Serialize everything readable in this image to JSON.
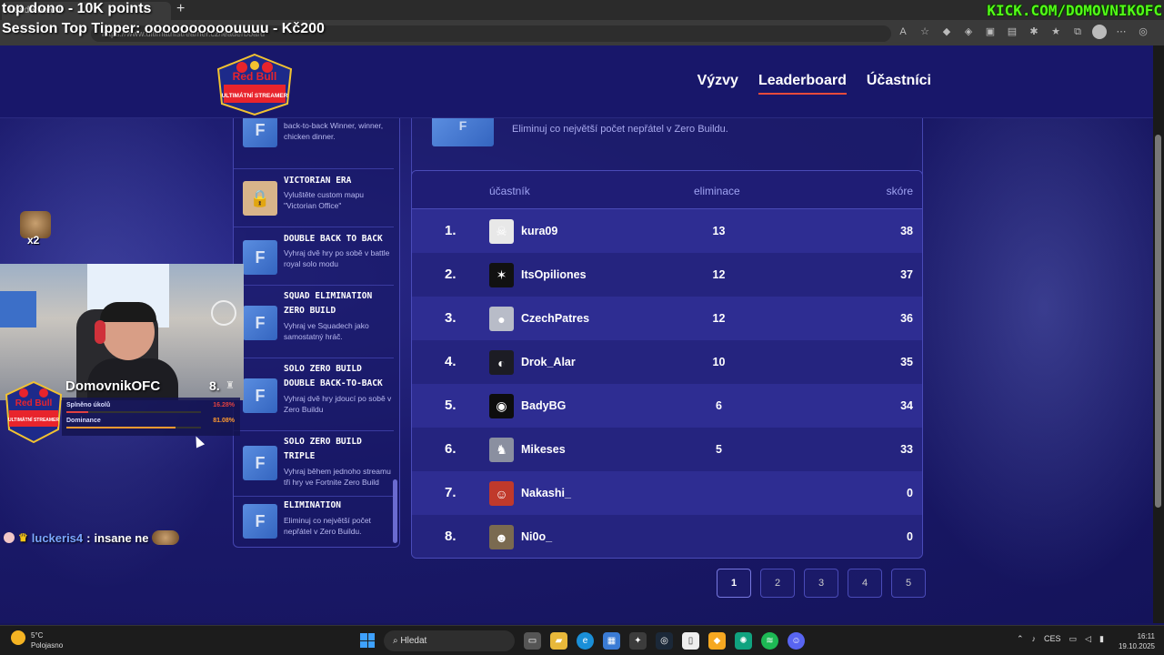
{
  "browser": {
    "tab_label": "Leaderboard",
    "url": "https://www.ultimatnistreamer.cz/leaderboard"
  },
  "site": {
    "logo_text_top": "Red Bull",
    "logo_text_bottom": "ULTIMÁTNÍ STREAMER",
    "nav": [
      {
        "label": "Výzvy",
        "active": false
      },
      {
        "label": "Leaderboard",
        "active": true
      },
      {
        "label": "Účastníci",
        "active": false
      }
    ],
    "challenges": [
      {
        "title": "",
        "desc": "back-to-back Winner, winner, chicken dinner.",
        "thumb": "F"
      },
      {
        "title": "VICTORIAN ERA",
        "desc": "Vyluštěte custom mapu \"Victorian Office\"",
        "thumb": "🔒"
      },
      {
        "title": "DOUBLE BACK TO BACK",
        "desc": "Vyhraj dvě hry po sobě v battle royal solo modu",
        "thumb": "F"
      },
      {
        "title": "SQUAD ELIMINATION ZERO BUILD",
        "desc": "Vyhraj ve Squadech jako samostatný hráč.",
        "thumb": "F"
      },
      {
        "title": "SOLO ZERO BUILD DOUBLE BACK-TO-BACK",
        "desc": "Vyhraj dvě hry jdoucí po sobě v Zero Buildu",
        "thumb": "F"
      },
      {
        "title": "SOLO ZERO BUILD TRIPLE",
        "desc": "Vyhraj během jednoho streamu tři hry ve Fortnite Zero Build",
        "thumb": "F"
      },
      {
        "title": "ELIMINATION",
        "desc": "Eliminuj co největší počet nepřátel v Zero Buildu.",
        "thumb": "F"
      }
    ],
    "info": {
      "thumb": "F",
      "desc": "Eliminuj co největší počet nepřátel v Zero Buildu."
    },
    "board": {
      "headers": {
        "participant": "účastník",
        "eliminations": "eliminace",
        "score": "skóre"
      },
      "rows": [
        {
          "rank": "1.",
          "name": "kura09",
          "elims": "13",
          "score": "38",
          "avatar_color": "#e8e8e8",
          "avatar_glyph": "☠"
        },
        {
          "rank": "2.",
          "name": "ItsOpiliones",
          "elims": "12",
          "score": "37",
          "avatar_color": "#111111",
          "avatar_glyph": "✶"
        },
        {
          "rank": "3.",
          "name": "CzechPatres",
          "elims": "12",
          "score": "36",
          "avatar_color": "#b8bcc8",
          "avatar_glyph": "●"
        },
        {
          "rank": "4.",
          "name": "Drok_Alar",
          "elims": "10",
          "score": "35",
          "avatar_color": "#1c1c24",
          "avatar_glyph": "◐"
        },
        {
          "rank": "5.",
          "name": "BadyBG",
          "elims": "6",
          "score": "34",
          "avatar_color": "#0d0d0d",
          "avatar_glyph": "◉"
        },
        {
          "rank": "6.",
          "name": "Mikeses",
          "elims": "5",
          "score": "33",
          "avatar_color": "#8a8fa0",
          "avatar_glyph": "♞"
        },
        {
          "rank": "7.",
          "name": "Nakashi_",
          "elims": "",
          "score": "0",
          "avatar_color": "#c0392b",
          "avatar_glyph": "☺"
        },
        {
          "rank": "8.",
          "name": "Ni0o_",
          "elims": "",
          "score": "0",
          "avatar_color": "#7a6a50",
          "avatar_glyph": "☻"
        }
      ]
    },
    "pages": [
      "1",
      "2",
      "3",
      "4",
      "5"
    ]
  },
  "stream": {
    "title_line1": "top dono - 10K points",
    "title_line2": "Session Top Tipper: oooooooooouuuu - Kč200",
    "kick_url": "KICK.COM/DOMOVNIKOFC",
    "sticker_count": "x2",
    "streamer": "DomovnikOFC",
    "streamer_rank": "8.",
    "stats": [
      {
        "label": "Splněno úkolů",
        "value": "16.28%",
        "fraction": 0.1628,
        "color": "#e04040"
      },
      {
        "label": "Dominance",
        "value": "81.08%",
        "fraction": 0.8108,
        "color": "#ff9a30"
      }
    ],
    "chat": {
      "user": "luckeris4",
      "sep": ":",
      "message": "insane ne"
    }
  },
  "taskbar": {
    "weather_temp": "5°C",
    "weather_desc": "Polojasno",
    "search_label": "Hledat",
    "lang": "CES",
    "time": "16:11",
    "date": "19.10.2025"
  }
}
